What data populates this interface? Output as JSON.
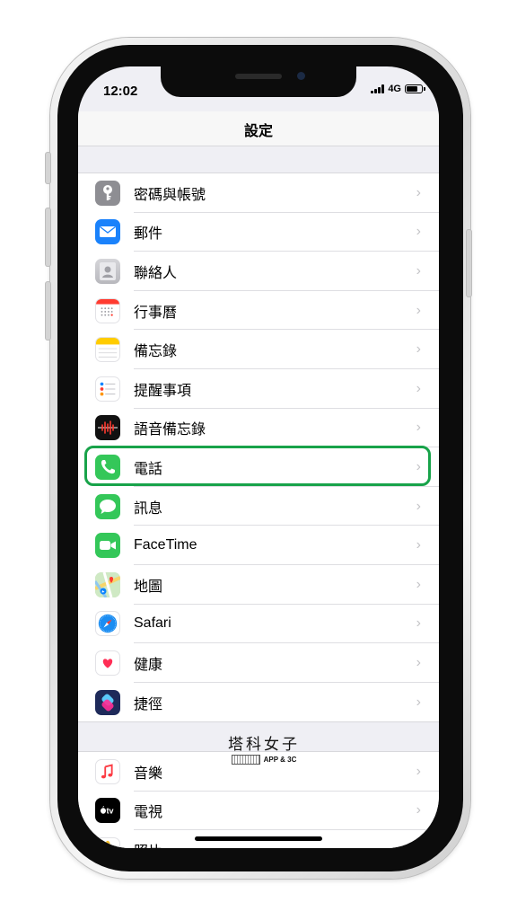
{
  "status_bar": {
    "time": "12:02",
    "network": "4G"
  },
  "nav": {
    "title": "設定"
  },
  "groups": [
    {
      "items": [
        {
          "label": "密碼與帳號",
          "icon": "key-icon",
          "color": "#8e8e93"
        },
        {
          "label": "郵件",
          "icon": "mail-icon",
          "color": "#1a82fb"
        },
        {
          "label": "聯絡人",
          "icon": "contacts-icon",
          "color": "#b8b8bd"
        },
        {
          "label": "行事曆",
          "icon": "calendar-icon",
          "color": "#ffffff"
        },
        {
          "label": "備忘錄",
          "icon": "notes-icon",
          "color": "#ffffff"
        },
        {
          "label": "提醒事項",
          "icon": "reminders-icon",
          "color": "#ffffff"
        },
        {
          "label": "語音備忘錄",
          "icon": "voice-memos-icon",
          "color": "#111111"
        },
        {
          "label": "電話",
          "icon": "phone-icon",
          "color": "#34c759"
        },
        {
          "label": "訊息",
          "icon": "messages-icon",
          "color": "#34c759"
        },
        {
          "label": "FaceTime",
          "icon": "facetime-icon",
          "color": "#34c759"
        },
        {
          "label": "地圖",
          "icon": "maps-icon",
          "color": "#8fc8f0"
        },
        {
          "label": "Safari",
          "icon": "safari-icon",
          "color": "#ffffff"
        },
        {
          "label": "健康",
          "icon": "health-icon",
          "color": "#ffffff"
        },
        {
          "label": "捷徑",
          "icon": "shortcuts-icon",
          "color": "#1e2a5a"
        }
      ]
    },
    {
      "items": [
        {
          "label": "音樂",
          "icon": "music-icon",
          "color": "#ffffff"
        },
        {
          "label": "電視",
          "icon": "tv-icon",
          "color": "#000000"
        },
        {
          "label": "照片",
          "icon": "photos-icon",
          "color": "#ffffff"
        }
      ]
    }
  ],
  "highlight_color": "#18a34a",
  "watermark": {
    "title": "塔科女子",
    "subtitle": "APP & 3C"
  }
}
